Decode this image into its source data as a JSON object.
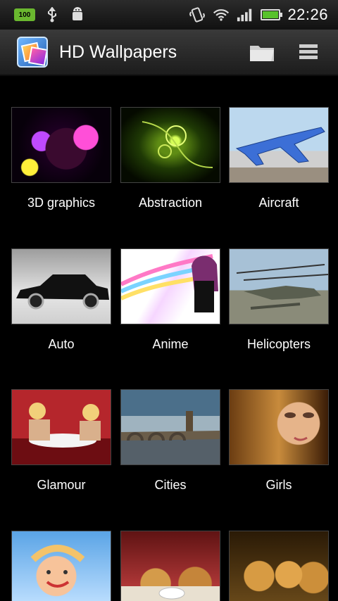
{
  "status_bar": {
    "battery_badge": "100",
    "time": "22:26"
  },
  "action_bar": {
    "title": "HD Wallpapers",
    "icons": [
      "folder-icon",
      "menu-list-icon"
    ]
  },
  "categories": [
    {
      "label": "3D graphics"
    },
    {
      "label": "Abstraction"
    },
    {
      "label": "Aircraft"
    },
    {
      "label": "Auto"
    },
    {
      "label": "Anime"
    },
    {
      "label": "Helicopters"
    },
    {
      "label": "Glamour"
    },
    {
      "label": "Cities"
    },
    {
      "label": "Girls"
    },
    {
      "label": ""
    },
    {
      "label": ""
    },
    {
      "label": ""
    }
  ]
}
